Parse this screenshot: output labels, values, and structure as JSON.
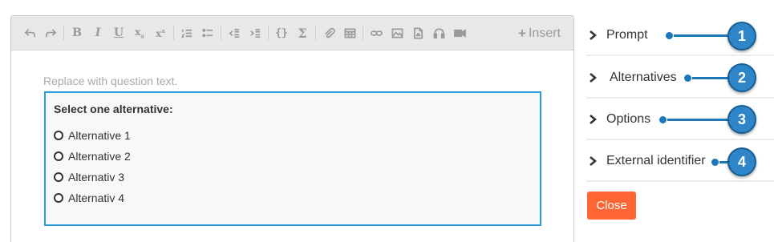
{
  "toolbar": {
    "insert_label": "Insert",
    "buttons": [
      "undo-icon",
      "redo-icon",
      "bold-icon",
      "italic-icon",
      "underline-icon",
      "subscript-icon",
      "superscript-icon",
      "ordered-list-icon",
      "unordered-list-icon",
      "outdent-icon",
      "indent-icon",
      "code-icon",
      "sigma-icon",
      "attachment-icon",
      "table-icon",
      "link-icon",
      "image-icon",
      "pdf-icon",
      "audio-icon",
      "video-icon"
    ]
  },
  "editor": {
    "placeholder": "Replace with question text.",
    "question_title": "Select one alternative:",
    "alternatives": [
      "Alternative 1",
      "Alternative 2",
      "Alternativ 3",
      "Alternativ 4"
    ]
  },
  "sidebar": {
    "items": [
      {
        "label": "Prompt"
      },
      {
        "label": "Alternatives"
      },
      {
        "label": "Options"
      },
      {
        "label": "External identifier"
      }
    ],
    "close_label": "Close"
  },
  "callouts": [
    "1",
    "2",
    "3",
    "4"
  ],
  "colors": {
    "accent_blue": "#2a9ce0",
    "callout_blue": "#2e86c8",
    "close_orange": "#ff6633"
  }
}
